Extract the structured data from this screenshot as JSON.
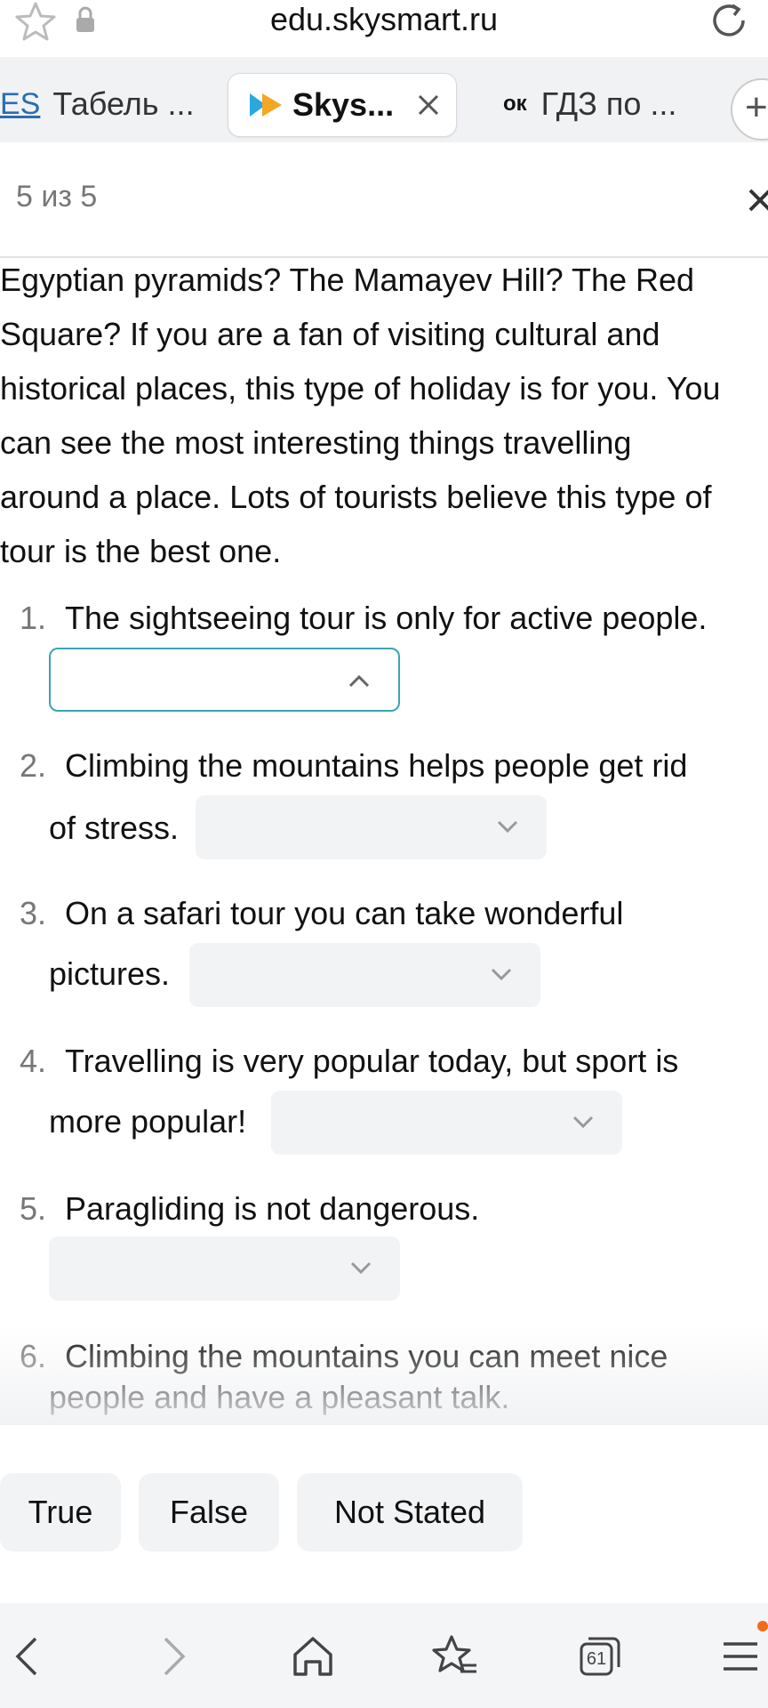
{
  "browser": {
    "url": "edu.skysmart.ru",
    "tabs": [
      {
        "badge": "ES",
        "label": "Табель ..."
      },
      {
        "label": "Skys...",
        "active": true
      },
      {
        "badge": "ок",
        "label": "ГДЗ по ..."
      }
    ],
    "new_tab": "+",
    "tab_count": "61"
  },
  "exercise": {
    "counter": "5 из 5"
  },
  "passage": [
    "Egyptian pyramids? The Mamayev Hill? The Red",
    "Square? If you are a fan of visiting cultural and",
    "historical places, this type of holiday is for you. You",
    "can see the most interesting things travelling",
    "around a place. Lots of tourists believe this type of",
    "tour is the best one."
  ],
  "questions": [
    {
      "num": "1.",
      "line1": "The sightseeing tour is only for active people.",
      "line2": ""
    },
    {
      "num": "2.",
      "line1": "Climbing the mountains helps people get rid",
      "line2": "of stress."
    },
    {
      "num": "3.",
      "line1": "On a safari tour you can take wonderful",
      "line2": "pictures."
    },
    {
      "num": "4.",
      "line1": "Travelling is very popular today, but sport is",
      "line2": "more popular!"
    },
    {
      "num": "5.",
      "line1": "Paragliding is not dangerous.",
      "line2": ""
    },
    {
      "num": "6.",
      "line1": "Climbing the mountains you can meet nice",
      "line2": "people and have a pleasant talk."
    }
  ],
  "options": [
    "True",
    "False",
    "Not Stated"
  ],
  "colors": {
    "accent": "#3aa6b5",
    "dropdown_bg": "#f2f3f5",
    "notification": "#f26b1d"
  }
}
